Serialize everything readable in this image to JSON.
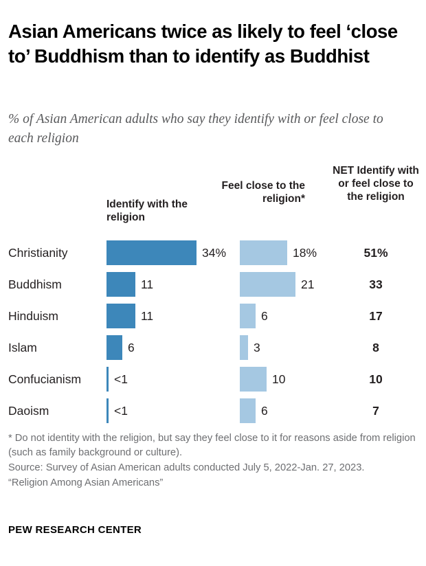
{
  "title": "Asian Americans twice as likely to feel ‘close to’ Buddhism than to identify as Buddhist",
  "subtitle": "% of Asian American adults who say they identify with or feel close to each religion",
  "headers": {
    "identify": "Identify with the religion",
    "feel_close": "Feel close to the religion*",
    "net": "NET Identify with or feel close to the religion"
  },
  "notes": {
    "footnote": "* Do not identity with the religion, but say they feel close to it for reasons aside from religion (such as family background or culture).",
    "source": "Source: Survey of Asian American adults conducted July 5, 2022-Jan. 27, 2023.",
    "report": "“Religion Among Asian Americans”"
  },
  "footer": "PEW RESEARCH CENTER",
  "colors": {
    "identify_bar": "#3d87ba",
    "feel_close_bar": "#a5c8e2",
    "text": "#231f20",
    "muted_text": "#6d6e71"
  },
  "chart_data": {
    "type": "bar",
    "title": "Asian Americans twice as likely to feel ‘close to’ Buddhism than to identify as Buddhist",
    "subtitle": "% of Asian American adults who say they identify with or feel close to each religion",
    "xlabel": "",
    "ylabel": "",
    "xlim": [
      0,
      34
    ],
    "grid": false,
    "legend": "none",
    "orientation": "horizontal",
    "categories": [
      "Christianity",
      "Buddhism",
      "Hinduism",
      "Islam",
      "Confucianism",
      "Daoism"
    ],
    "series": [
      {
        "name": "Identify with the religion",
        "color": "#3d87ba",
        "values": [
          34,
          11,
          11,
          6,
          0.5,
          0.5
        ],
        "labels": [
          "34%",
          "11",
          "11",
          "6",
          "<1",
          "<1"
        ]
      },
      {
        "name": "Feel close to the religion*",
        "color": "#a5c8e2",
        "values": [
          18,
          21,
          6,
          3,
          10,
          6
        ],
        "labels": [
          "18%",
          "21",
          "6",
          "3",
          "10",
          "6"
        ]
      },
      {
        "name": "NET Identify with or feel close to the religion",
        "color": "#231f20",
        "values": [
          51,
          33,
          17,
          8,
          10,
          7
        ],
        "labels": [
          "51%",
          "33",
          "17",
          "8",
          "10",
          "7"
        ]
      }
    ],
    "annotations": [
      "* Do not identity with the religion, but say they feel close to it for reasons aside from religion (such as family background or culture).",
      "Source: Survey of Asian American adults conducted July 5, 2022-Jan. 27, 2023.",
      "“Religion Among Asian Americans”",
      "PEW RESEARCH CENTER"
    ]
  }
}
